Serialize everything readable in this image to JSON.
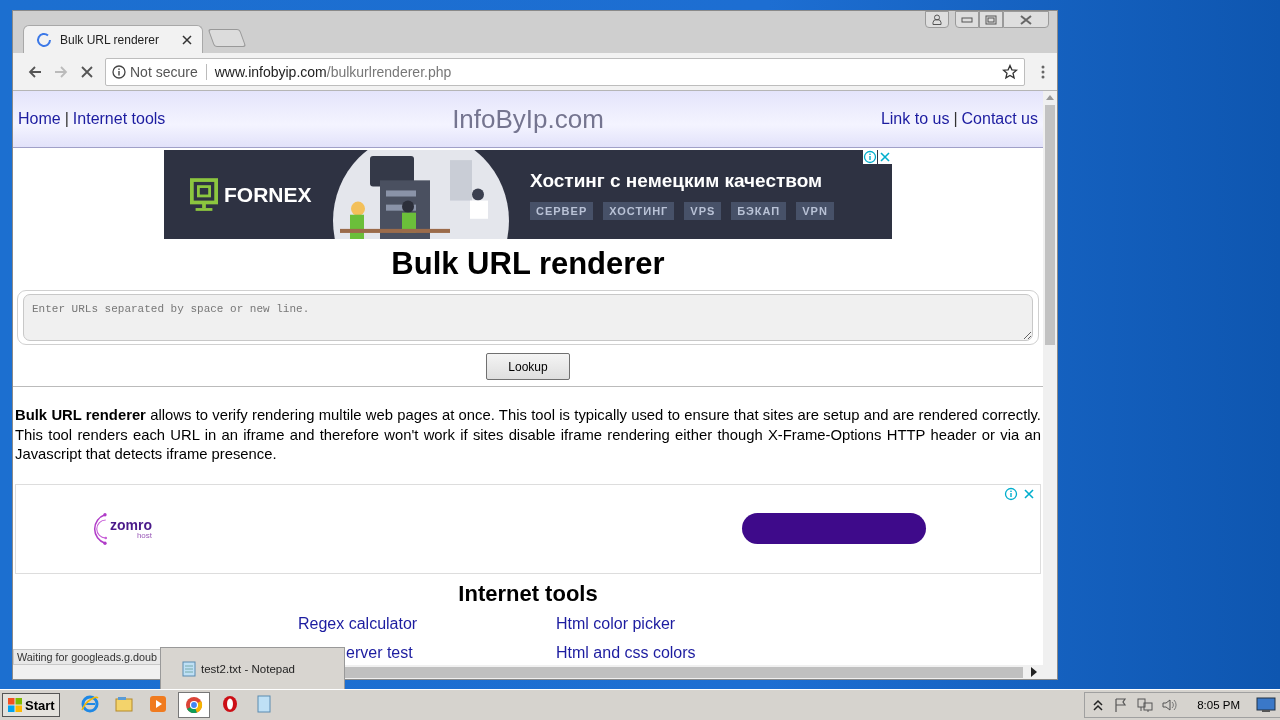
{
  "browser": {
    "tabs": [
      {
        "title": "Bulk URL renderer",
        "selected": true,
        "loading": true
      }
    ],
    "address": {
      "security": "Not secure",
      "host": "www.infobyip.com",
      "path": "/bulkurlrenderer.php"
    },
    "status_text": "Waiting for googleads.g.doub"
  },
  "page": {
    "nav_left": [
      {
        "kind": "link",
        "text": "Home"
      },
      {
        "kind": "separator",
        "text": "|"
      },
      {
        "kind": "link",
        "text": "Internet tools"
      }
    ],
    "site_title": "InfoByIp.com",
    "nav_right": [
      {
        "kind": "link",
        "text": "Link to us"
      },
      {
        "kind": "separator",
        "text": "|"
      },
      {
        "kind": "link",
        "text": "Contact us"
      }
    ],
    "ad_banner": {
      "brand": "FORNEX",
      "headline": "Хостинг с немецким качеством",
      "tags": [
        "СЕРВЕР",
        "ХОСТИНГ",
        "VPS",
        "БЭКАП",
        "VPN"
      ]
    },
    "heading": "Bulk URL renderer",
    "url_input": {
      "placeholder": "Enter URLs separated by space or new line."
    },
    "lookup_button": "Lookup",
    "description": "**Bulk URL renderer** allows to verify rendering multile web pages at once. This tool is typically used to ensure that sites are setup and are rendered correctly. This tool renders each URL in an iframe and therefore won't work if sites disable iframe rendering either though X-Frame-Options HTTP header or via an Javascript that detects iframe presence.",
    "ad_banner_2": {
      "brand": "zomro",
      "sub": "host"
    },
    "tools_heading": "Internet tools",
    "tools_links": [
      "Regex calculator",
      "Html color picker",
      "erver test",
      "Html and css colors"
    ]
  },
  "taskbar": {
    "start": "Start",
    "apps": [
      {
        "kind": "ie",
        "selected": false
      },
      {
        "kind": "folder",
        "selected": false
      },
      {
        "kind": "media",
        "selected": false
      },
      {
        "kind": "chrome",
        "selected": true
      },
      {
        "kind": "opera",
        "selected": false
      },
      {
        "kind": "notepad",
        "selected": false
      }
    ],
    "preview": "test2.txt - Notepad",
    "clock": "8:05 PM"
  }
}
